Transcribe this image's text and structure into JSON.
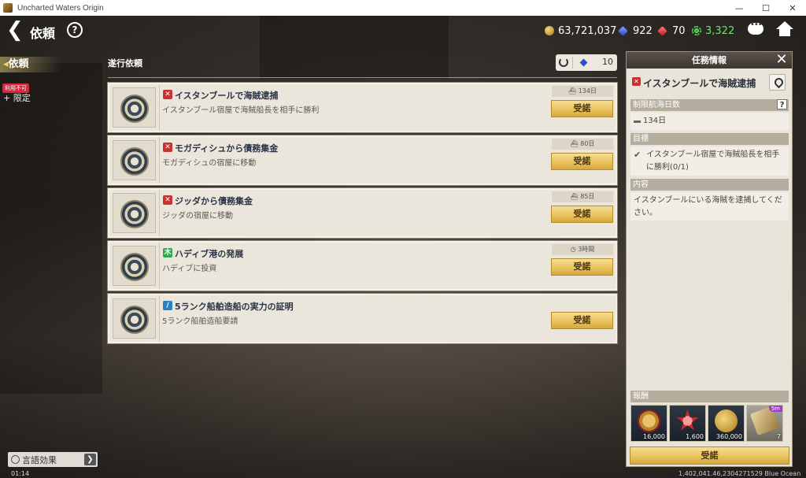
{
  "window": {
    "title": "Uncharted Waters Origin",
    "minimize": "—",
    "maximize": "☐",
    "close": "✕"
  },
  "header": {
    "back": "❮",
    "title": "依頼",
    "help": "?",
    "currencies": {
      "gold": "63,721,037",
      "gems": "922",
      "rubies": "70",
      "gears": "3,322"
    },
    "gear_color": "#6fe06f"
  },
  "sidebar": {
    "tab_label": "依頼",
    "badge": "利用不可",
    "sub_item": "+ 限定",
    "language_effect": "言語効果",
    "language_arrow": "❯"
  },
  "list": {
    "header": "遂行依頼",
    "refresh_cost": "10",
    "quests": [
      {
        "type_icon": "✕",
        "title": "イスタンブールで海賊逮捕",
        "desc": "イスタンブール宿屋で海賊船長を相手に勝利",
        "limit": "134日",
        "accept": "受諾"
      },
      {
        "type_icon": "✕",
        "title": "モガディシュから債務集金",
        "desc": "モガディシュの宿屋に移動",
        "limit": "80日",
        "accept": "受諾"
      },
      {
        "type_icon": "✕",
        "title": "ジッダから債務集金",
        "desc": "ジッダの宿屋に移動",
        "limit": "85日",
        "accept": "受諾"
      },
      {
        "type_icon": "木",
        "title": "ハディブ港の発展",
        "desc": "ハディブに投資",
        "limit": "3時間",
        "accept": "受諾"
      },
      {
        "type_icon": "/",
        "title": "5ランク船舶造船の実力の証明",
        "desc": "5ランク船舶造船要請",
        "limit": "",
        "accept": "受諾"
      }
    ]
  },
  "info_panel": {
    "header": "任務情報",
    "close": "✕",
    "quest_icon": "✕",
    "quest_title": "イスタンブールで海賊逮捕",
    "limit_head": "制限航海日数",
    "limit_help": "?",
    "limit_value": "134日",
    "goal_head": "目標",
    "goal_check": "✔",
    "goal_text": "イスタンブール宿屋で海賊船長を相手に勝利(0/1)",
    "content_head": "内容",
    "content_text": "イスタンブールにいる海賊を逮捕してください。",
    "reward_head": "報酬",
    "rewards": [
      {
        "qty": "16,000"
      },
      {
        "qty": "1,600"
      },
      {
        "qty": "360,000"
      },
      {
        "qty": "7",
        "tag": "5m"
      }
    ],
    "accept": "受諾"
  },
  "status": {
    "clock": "01:14",
    "coords": "1,402,041.46,2304271529 Blue Ocean"
  }
}
